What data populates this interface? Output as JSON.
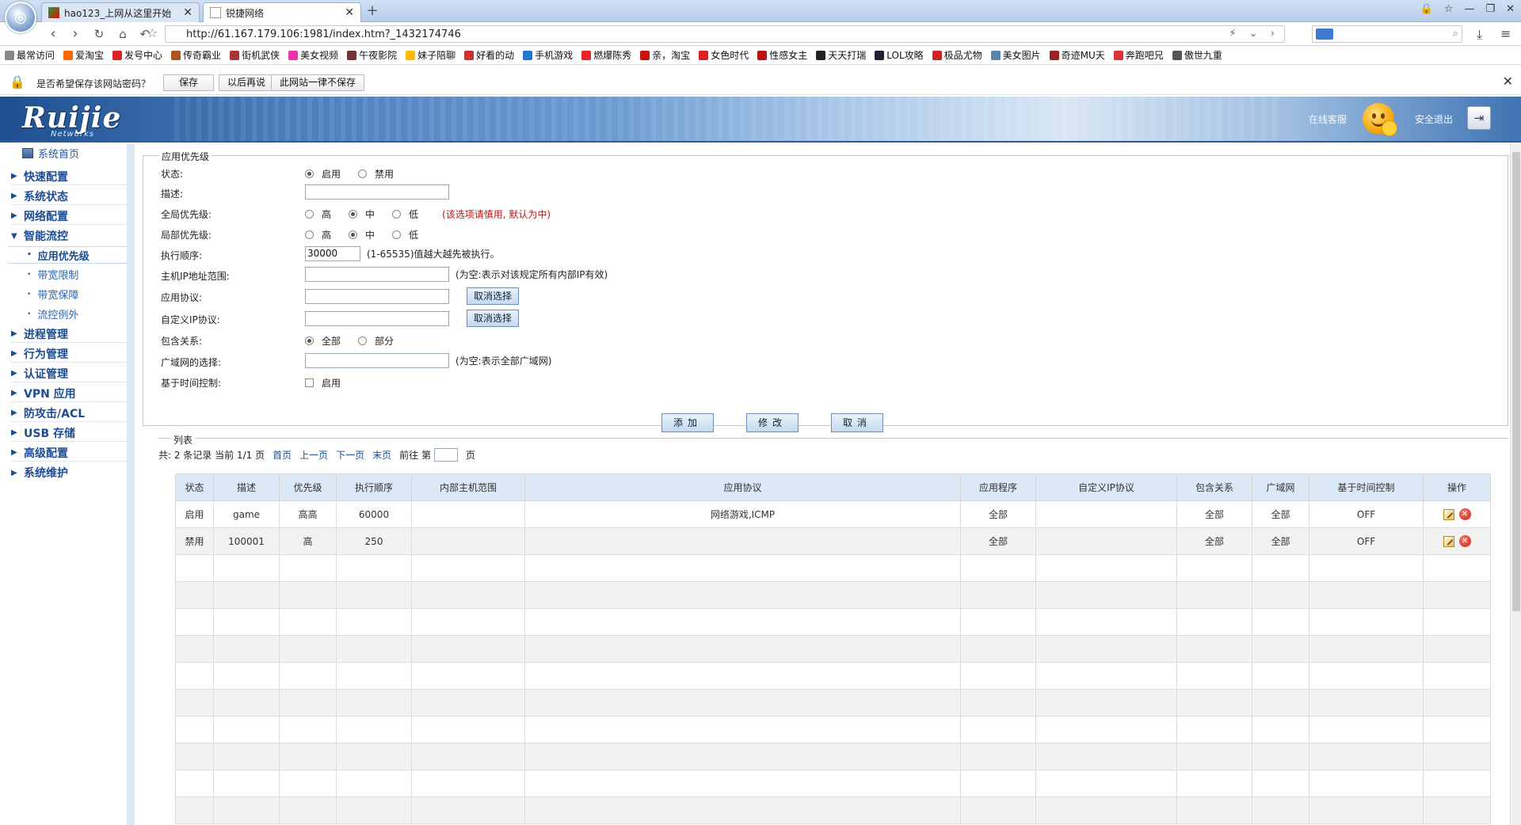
{
  "browser": {
    "tabs": [
      {
        "title": "hao123_上网从这里开始"
      },
      {
        "title": "锐捷网络"
      }
    ],
    "address": "http://61.167.179.106:1981/index.htm?_1432174746",
    "bookmarks": [
      "最常访问",
      "爱淘宝",
      "发号中心",
      "传奇霸业",
      "街机武侠",
      "美女视频",
      "午夜影院",
      "妹子陪聊",
      "好看的动",
      "手机游戏",
      "燃爆陈秀",
      "亲，淘宝",
      "女色时代",
      "性感女主",
      "天天打瑞",
      "LOL攻略",
      "极品尤物",
      "美女图片",
      "奇迹MU天",
      "奔跑吧兄",
      "傲世九重"
    ]
  },
  "password_bar": {
    "prompt": "是否希望保存该网站密码？",
    "save": "保存",
    "later": "以后再说",
    "never": "此网站一律不保存"
  },
  "header": {
    "logo": "Ruijie",
    "logo_sub": "Networks",
    "online_service": "在线客服",
    "logout": "安全退出"
  },
  "sidebar": {
    "home": "系统首页",
    "categories": [
      "快速配置",
      "系统状态",
      "网络配置",
      "智能流控",
      "进程管理",
      "行为管理",
      "认证管理",
      "VPN 应用",
      "防攻击/ACL",
      "USB 存储",
      "高级配置",
      "系统维护"
    ],
    "sub_items": [
      "应用优先级",
      "带宽限制",
      "带宽保障",
      "流控例外"
    ]
  },
  "form": {
    "legend": "应用优先级",
    "status_label": "状态:",
    "status_on": "启用",
    "status_off": "禁用",
    "desc_label": "描述:",
    "desc_value": "",
    "global_label": "全局优先级:",
    "local_label": "局部优先级:",
    "high": "高",
    "mid": "中",
    "low": "低",
    "global_note": "(该选项请慎用, 默认为中)",
    "order_label": "执行顺序:",
    "order_value": "30000",
    "order_note": "(1-65535)值越大越先被执行。",
    "ip_label": "主机IP地址范围:",
    "ip_note": "(为空:表示对该规定所有内部IP有效)",
    "proto_label": "应用协议:",
    "custom_label": "自定义IP协议:",
    "deselect": "取消选择",
    "include_label": "包含关系:",
    "include_all": "全部",
    "include_part": "部分",
    "wan_label": "广域网的选择:",
    "wan_note": "(为空:表示全部广域网)",
    "time_label": "基于时间控制:",
    "time_enable": "启用",
    "add": "添加",
    "modify": "修改",
    "cancel": "取消"
  },
  "list": {
    "legend": "列表",
    "pager": {
      "summary": "共: 2 条记录 当前 1/1 页",
      "first": "首页",
      "prev": "上一页",
      "next": "下一页",
      "last": "末页",
      "goto": "前往 第",
      "page": "页"
    },
    "headers": [
      "状态",
      "描述",
      "优先级",
      "执行顺序",
      "内部主机范围",
      "应用协议",
      "应用程序",
      "自定义IP协议",
      "包含关系",
      "广域网",
      "基于时间控制",
      "操作"
    ],
    "rows": [
      [
        "启用",
        "game",
        "高高",
        "60000",
        "",
        "网络游戏,ICMP",
        "全部",
        "",
        "全部",
        "全部",
        "OFF"
      ],
      [
        "禁用",
        "100001",
        "高",
        "250",
        "",
        "",
        "全部",
        "",
        "全部",
        "全部",
        "OFF"
      ]
    ]
  }
}
